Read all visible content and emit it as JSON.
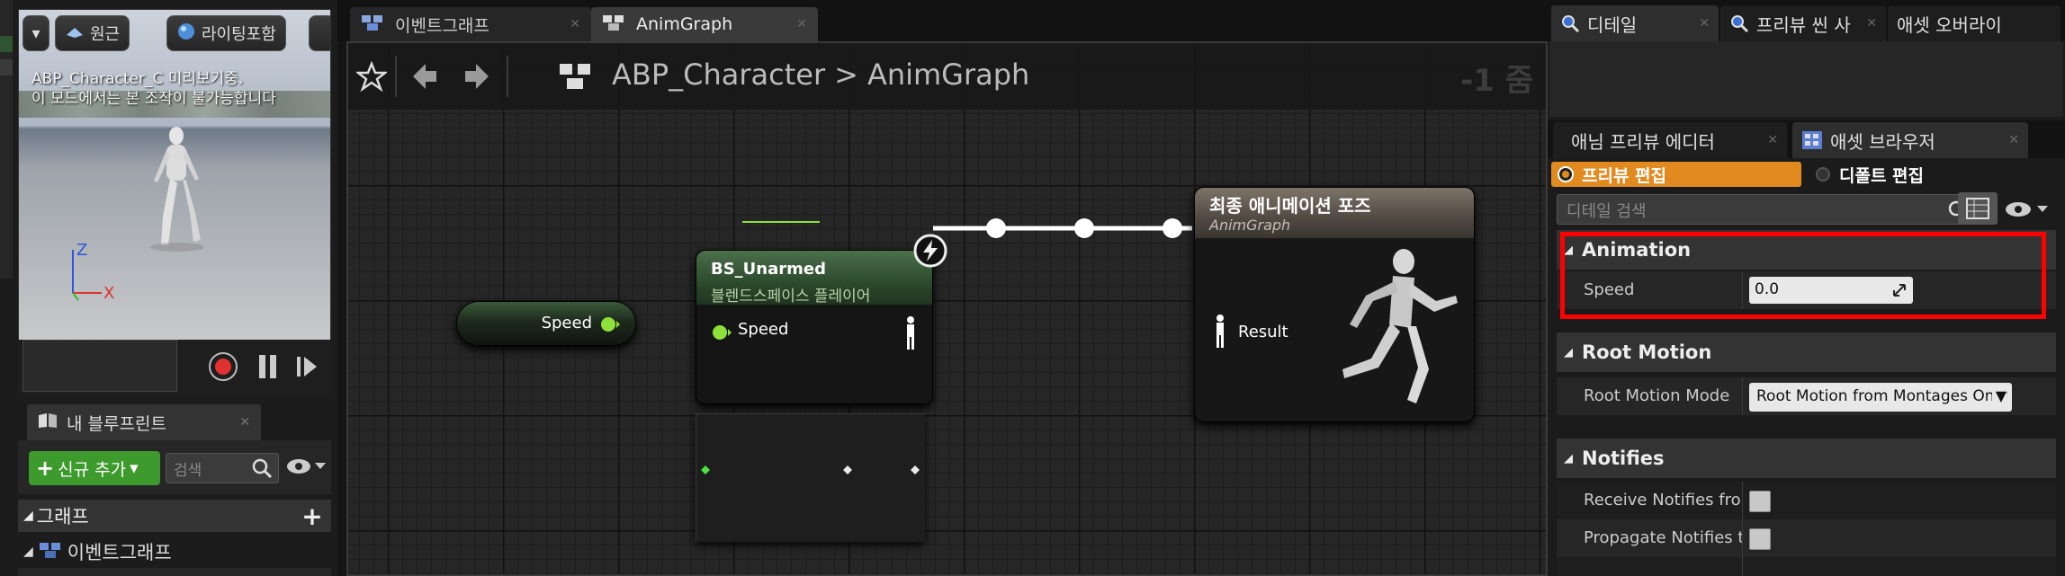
{
  "viewport": {
    "mode_buttons": [
      {
        "label": "원근",
        "icon": "perspective-icon"
      },
      {
        "label": "라이팅포함",
        "icon": "lit-sphere-icon"
      }
    ],
    "message_line1": "ABP_Character_C 미리보기중.",
    "message_line2": "이 모드에서는 본 조작이 불가능합니다",
    "axis_z": "Z",
    "axis_x": "X"
  },
  "my_blueprint": {
    "tab_label": "내 블루프린트",
    "add_new_label": "신규 추가",
    "search_placeholder": "검색",
    "graph_header": "그래프",
    "event_graph_item": "이벤트그래프"
  },
  "editor_tabs": [
    {
      "label": "이벤트그래프"
    },
    {
      "label": "AnimGraph"
    }
  ],
  "graph": {
    "breadcrumb_root": "ABP_Character",
    "breadcrumb_separator": ">",
    "breadcrumb_current": "AnimGraph",
    "zoom_label": "-1 줌",
    "speed_node_label": "Speed",
    "blendspace_node": {
      "title": "BS_Unarmed",
      "subtitle": "블렌드스페이스 플레이어",
      "input_pin": "Speed"
    },
    "final_pose_node": {
      "title": "최종 애니메이션 포즈",
      "subtitle": "AnimGraph",
      "result_pin": "Result"
    }
  },
  "right_panel": {
    "top_tabs": [
      {
        "label": "디테일"
      },
      {
        "label": "프리뷰 씬 사"
      },
      {
        "label": "애셋 오버라이"
      }
    ],
    "second_tabs": [
      {
        "label": "애님 프리뷰 에디터"
      },
      {
        "label": "애셋 브라우저"
      }
    ],
    "mode_active": "프리뷰 편집",
    "mode_inactive": "디폴트 편집",
    "search_placeholder": "디테일 검색",
    "categories": {
      "animation": "Animation",
      "root_motion": "Root Motion",
      "notifies": "Notifies"
    },
    "properties": {
      "speed_label": "Speed",
      "speed_value": "0.0",
      "root_motion_mode_label": "Root Motion Mode",
      "root_motion_mode_value": "Root Motion from Montages Only",
      "receive_notifies_label": "Receive Notifies from Linked Instances",
      "propagate_notifies_label": "Propagate Notifies to Linked Instances"
    }
  },
  "colors": {
    "accent_orange": "#e08a20",
    "exec_green": "#8fe03a",
    "highlight_red": "#ff0000",
    "add_button_green": "#3d9a2c"
  }
}
